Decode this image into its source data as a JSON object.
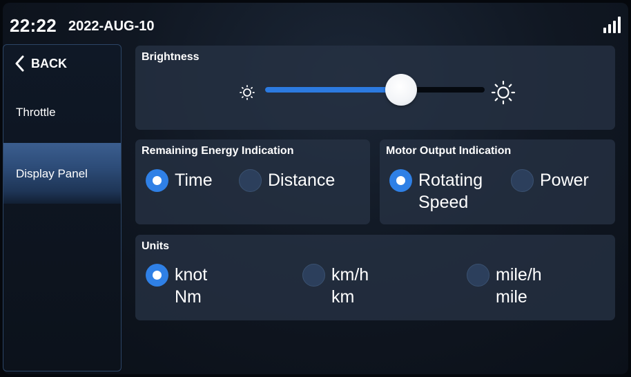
{
  "status": {
    "time": "22:22",
    "date": "2022-AUG-10",
    "signal_icon": "signal-bars-icon"
  },
  "sidebar": {
    "back_label": "BACK",
    "items": [
      {
        "label": "Throttle",
        "active": false
      },
      {
        "label": "Display Panel",
        "active": true
      }
    ]
  },
  "brightness": {
    "title": "Brightness",
    "level": 0.62,
    "low_icon": "brightness-low-icon",
    "high_icon": "brightness-high-icon"
  },
  "remaining_energy": {
    "title": "Remaining Energy Indication",
    "options": [
      {
        "label": "Time",
        "selected": true
      },
      {
        "label": "Distance",
        "selected": false
      }
    ]
  },
  "motor_output": {
    "title": "Motor Output Indication",
    "options": [
      {
        "line1": "Rotating",
        "line2": "Speed",
        "selected": true
      },
      {
        "label": "Power",
        "selected": false
      }
    ]
  },
  "units": {
    "title": "Units",
    "options": [
      {
        "line1": "knot",
        "line2": "Nm",
        "selected": true
      },
      {
        "line1": "km/h",
        "line2": "km",
        "selected": false
      },
      {
        "line1": "mile/h",
        "line2": "mile",
        "selected": false
      }
    ]
  },
  "colors": {
    "accent": "#2f80e6",
    "panel": "#263244",
    "sidebar_active": "#2d4c78"
  }
}
